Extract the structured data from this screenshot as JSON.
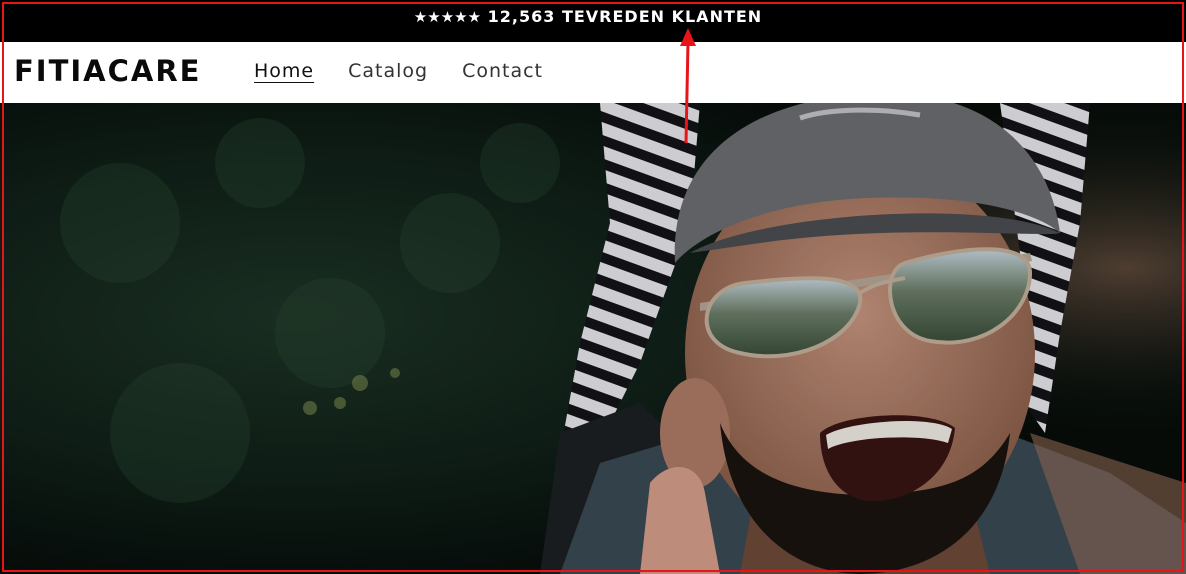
{
  "announcement": {
    "stars": "★★★★★",
    "text": "12,563 TEVREDEN KLANTEN"
  },
  "header": {
    "logo": "FITIACARE",
    "nav": [
      {
        "label": "Home",
        "active": true
      },
      {
        "label": "Catalog",
        "active": false
      },
      {
        "label": "Contact",
        "active": false
      }
    ]
  },
  "hero": {
    "image": "smiling-man-with-child-on-shoulders-photo"
  },
  "annotation": {
    "color": "#e8141c",
    "target": "announcement-text"
  }
}
